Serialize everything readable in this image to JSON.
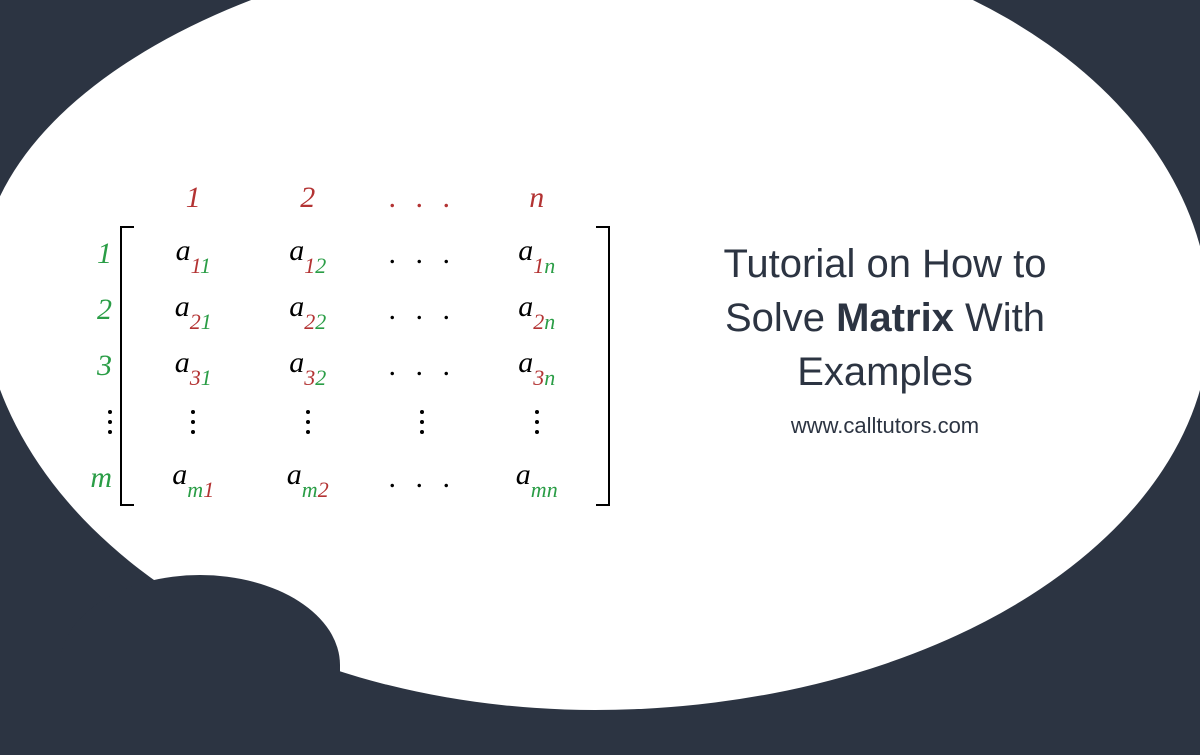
{
  "matrix": {
    "col_headers": [
      "1",
      "2",
      ". . .",
      "n"
    ],
    "row_headers": [
      "1",
      "2",
      "3",
      "⋮",
      "m"
    ],
    "cells": [
      [
        {
          "a": "a",
          "i": "1",
          "j": "1"
        },
        {
          "a": "a",
          "i": "1",
          "j": "2"
        },
        {
          "dots": ". . ."
        },
        {
          "a": "a",
          "i": "1",
          "j": "n"
        }
      ],
      [
        {
          "a": "a",
          "i": "2",
          "j": "1"
        },
        {
          "a": "a",
          "i": "2",
          "j": "2"
        },
        {
          "dots": ". . ."
        },
        {
          "a": "a",
          "i": "2",
          "j": "n"
        }
      ],
      [
        {
          "a": "a",
          "i": "3",
          "j": "1"
        },
        {
          "a": "a",
          "i": "3",
          "j": "2"
        },
        {
          "dots": ". . ."
        },
        {
          "a": "a",
          "i": "3",
          "j": "n"
        }
      ],
      [
        {
          "vdots": true
        },
        {
          "vdots": true
        },
        {
          "vdots": true
        },
        {
          "vdots": true
        }
      ],
      [
        {
          "a": "a",
          "i": "m",
          "j": "1"
        },
        {
          "a": "a",
          "i": "m",
          "j": "2"
        },
        {
          "dots": ". . ."
        },
        {
          "a": "a",
          "i": "m",
          "j": "n"
        }
      ]
    ]
  },
  "title": {
    "line1": "Tutorial on How to",
    "line2_pre": "Solve ",
    "line2_strong": "Matrix",
    "line2_post": " With",
    "line3": "Examples"
  },
  "subtitle": "www.calltutors.com"
}
